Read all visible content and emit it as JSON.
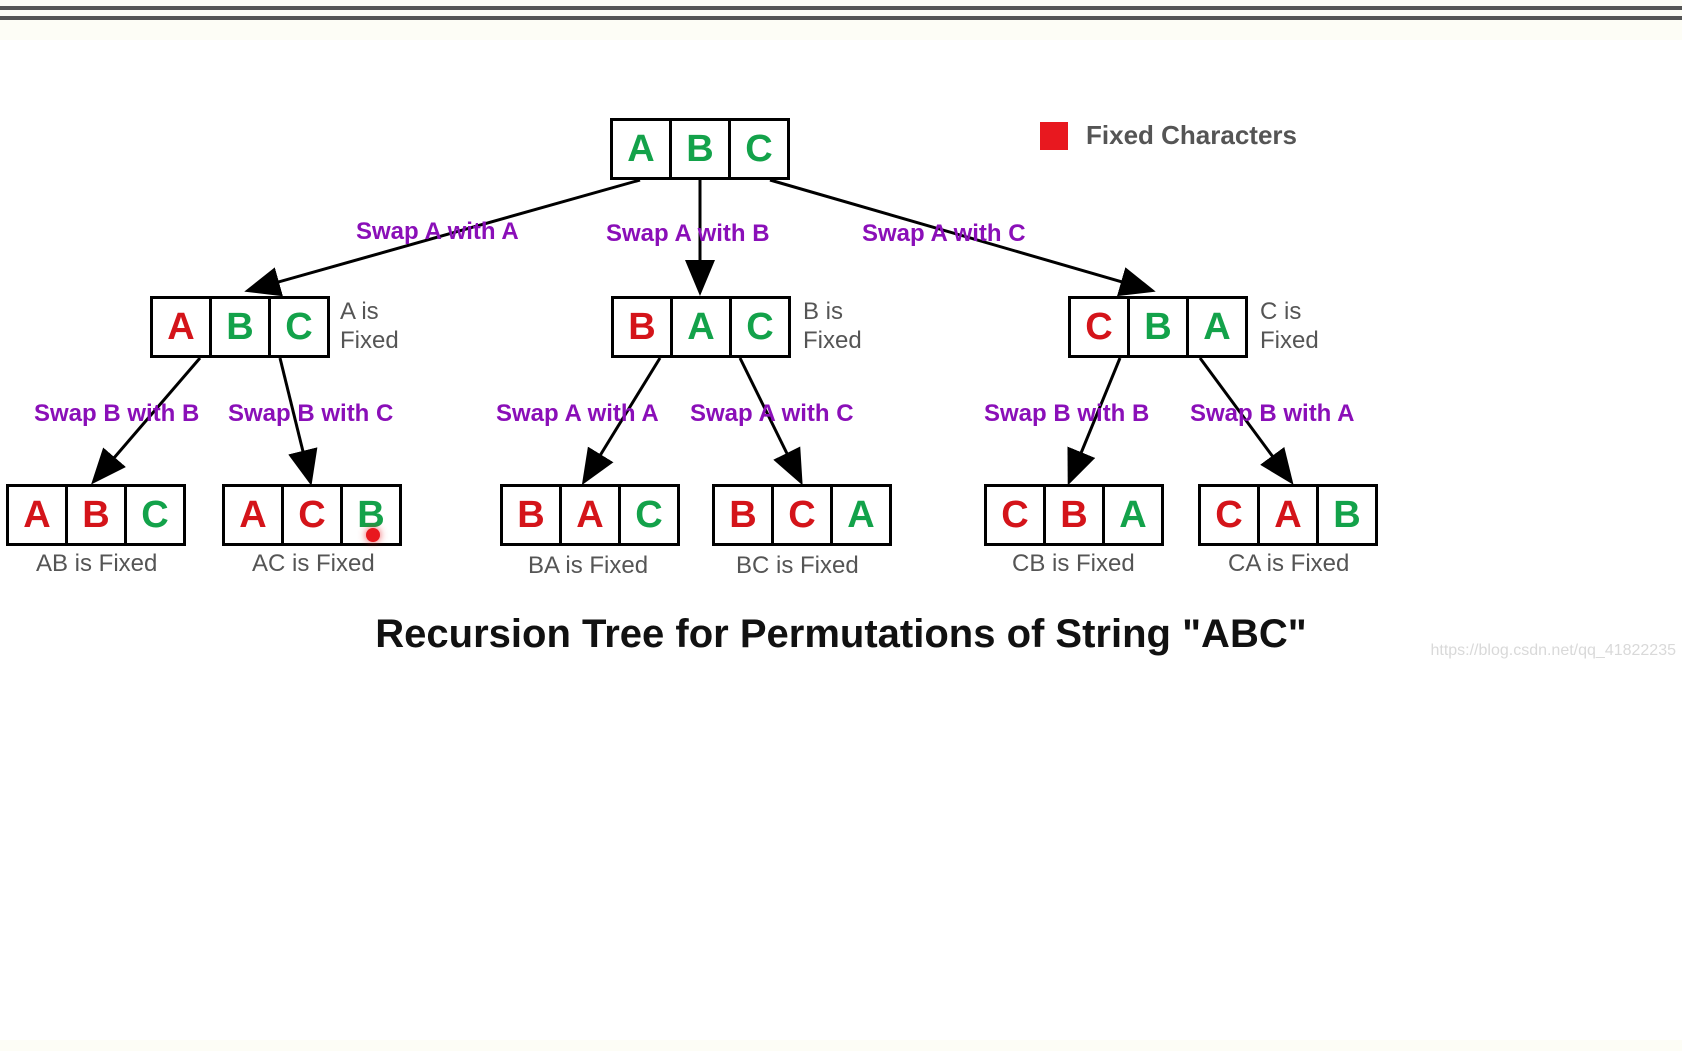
{
  "legend": {
    "label": "Fixed Characters"
  },
  "title": "Recursion Tree for Permutations of String \"ABC\"",
  "watermark": "https://blog.csdn.net/qq_41822235",
  "root": {
    "cells": [
      "A",
      "B",
      "C"
    ],
    "colors": [
      "g",
      "g",
      "g"
    ]
  },
  "level1_swap_labels": {
    "left": "Swap A with A",
    "mid": "Swap A with B",
    "right": "Swap A with C"
  },
  "level1": [
    {
      "cells": [
        "A",
        "B",
        "C"
      ],
      "colors": [
        "r",
        "g",
        "g"
      ],
      "fixed": "A is\nFixed"
    },
    {
      "cells": [
        "B",
        "A",
        "C"
      ],
      "colors": [
        "r",
        "g",
        "g"
      ],
      "fixed": "B is\nFixed"
    },
    {
      "cells": [
        "C",
        "B",
        "A"
      ],
      "colors": [
        "r",
        "g",
        "g"
      ],
      "fixed": "C is\nFixed"
    }
  ],
  "level2_swap_labels": {
    "l0": "Swap B with B",
    "l1": "Swap B with C",
    "m0": "Swap A with A",
    "m1": "Swap A with C",
    "r0": "Swap B with B",
    "r1": "Swap B with A"
  },
  "leaves": [
    {
      "cells": [
        "A",
        "B",
        "C"
      ],
      "colors": [
        "r",
        "r",
        "g"
      ],
      "fixed": "AB is Fixed"
    },
    {
      "cells": [
        "A",
        "C",
        "B"
      ],
      "colors": [
        "r",
        "r",
        "g"
      ],
      "fixed": "AC is Fixed"
    },
    {
      "cells": [
        "B",
        "A",
        "C"
      ],
      "colors": [
        "r",
        "r",
        "g"
      ],
      "fixed": "BA is Fixed"
    },
    {
      "cells": [
        "B",
        "C",
        "A"
      ],
      "colors": [
        "r",
        "r",
        "g"
      ],
      "fixed": "BC is Fixed"
    },
    {
      "cells": [
        "C",
        "B",
        "A"
      ],
      "colors": [
        "r",
        "r",
        "g"
      ],
      "fixed": "CB is Fixed"
    },
    {
      "cells": [
        "C",
        "A",
        "B"
      ],
      "colors": [
        "r",
        "r",
        "g"
      ],
      "fixed": "CA is Fixed"
    }
  ]
}
